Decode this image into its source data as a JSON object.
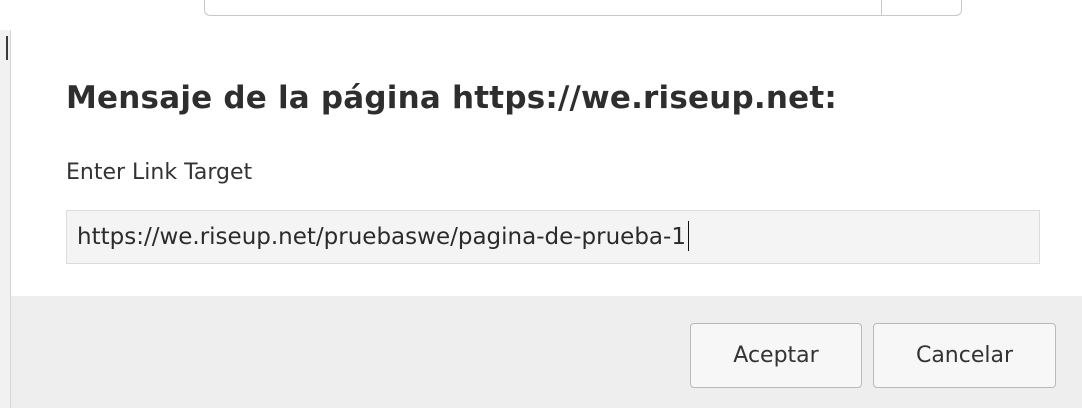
{
  "dialog": {
    "title": "Mensaje de la página https://we.riseup.net:",
    "prompt_label": "Enter Link Target",
    "input_value": "https://we.riseup.net/pruebaswe/pagina-de-prueba-1",
    "accept_label": "Aceptar",
    "cancel_label": "Cancelar"
  },
  "colors": {
    "button_bar": "#eeeeee",
    "input_background": "#f4f4f4",
    "title_text": "#2e2e2e"
  }
}
